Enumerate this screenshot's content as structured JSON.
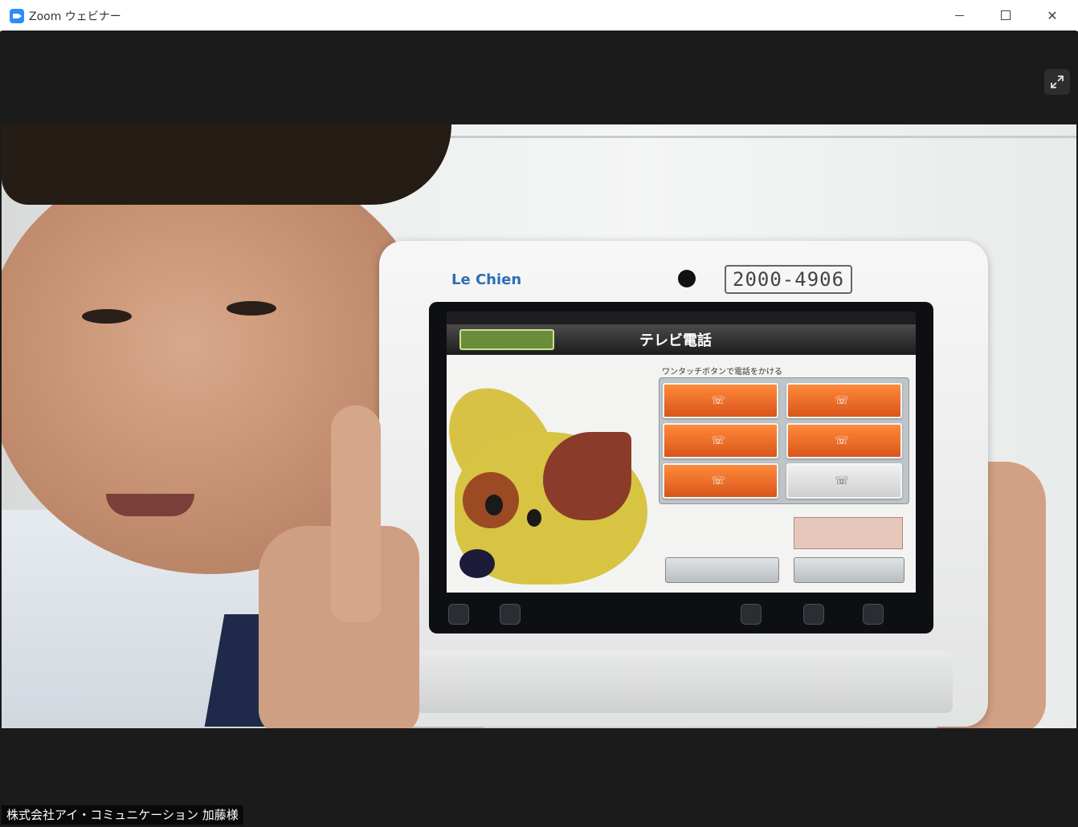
{
  "window": {
    "title": "Zoom ウェビナー",
    "minimize_glyph": "",
    "maximize_glyph": "",
    "close_glyph": "✕"
  },
  "video": {
    "fullscreen_glyph": "⤢",
    "tablet": {
      "brand": "Le Chien",
      "serial": "2000-4906",
      "screen": {
        "status_time": "",
        "back_button": "",
        "title": "テレビ電話",
        "instruction": "ワンタッチボタンで電話をかける",
        "call_buttons": [
          "",
          "",
          "",
          "",
          "",
          ""
        ],
        "bottom_button": ""
      }
    }
  },
  "participant": {
    "name": "株式会社アイ・コミュニケーション 加藤様"
  },
  "colors": {
    "titlebar": "#ffffff",
    "video_bg": "#1b1b1b",
    "zoom_blue": "#2d8cff",
    "call_button": "#e86a2a"
  }
}
